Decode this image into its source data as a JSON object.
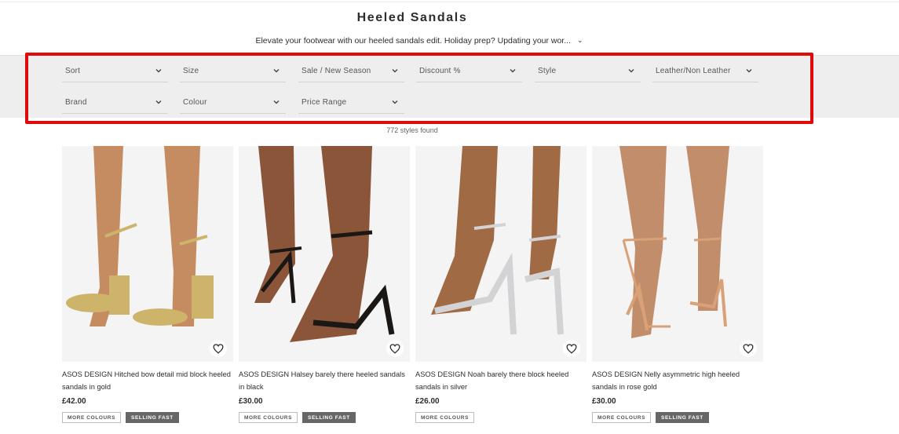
{
  "page": {
    "title": "Heeled Sandals",
    "intro": "Elevate your footwear with our heeled sandals edit. Holiday prep? Updating your wor...",
    "results_count": "772 styles found"
  },
  "filters": [
    {
      "label": "Sort"
    },
    {
      "label": "Size"
    },
    {
      "label": "Sale / New Season"
    },
    {
      "label": "Discount %"
    },
    {
      "label": "Style"
    },
    {
      "label": "Leather/Non Leather"
    },
    {
      "label": "Brand"
    },
    {
      "label": "Colour"
    },
    {
      "label": "Price Range"
    }
  ],
  "products": [
    {
      "title": "ASOS DESIGN Hitched bow detail mid block heeled sandals in gold",
      "price": "£42.00",
      "badges": [
        "MORE COLOURS",
        "SELLING FAST"
      ],
      "shoe_color": "#cdb46a",
      "skin": "#c48c60"
    },
    {
      "title": "ASOS DESIGN Halsey barely there heeled sandals in black",
      "price": "£30.00",
      "badges": [
        "MORE COLOURS",
        "SELLING FAST"
      ],
      "shoe_color": "#1b1714",
      "skin": "#8a5538"
    },
    {
      "title": "ASOS DESIGN Noah barely there block heeled sandals in silver",
      "price": "£26.00",
      "badges": [
        "MORE COLOURS"
      ],
      "shoe_color": "#d3d3d6",
      "skin": "#a06a45"
    },
    {
      "title": "ASOS DESIGN Nelly asymmetric high heeled sandals in rose gold",
      "price": "£30.00",
      "badges": [
        "MORE COLOURS",
        "SELLING FAST"
      ],
      "shoe_color": "#d9a177",
      "skin": "#c28d6a"
    }
  ],
  "colors": {
    "highlight": "#e00a0a",
    "filter_band": "#eeeeee"
  },
  "icons": {
    "filter_chevron": "chevron-down-icon",
    "wishlist": "heart-icon"
  }
}
